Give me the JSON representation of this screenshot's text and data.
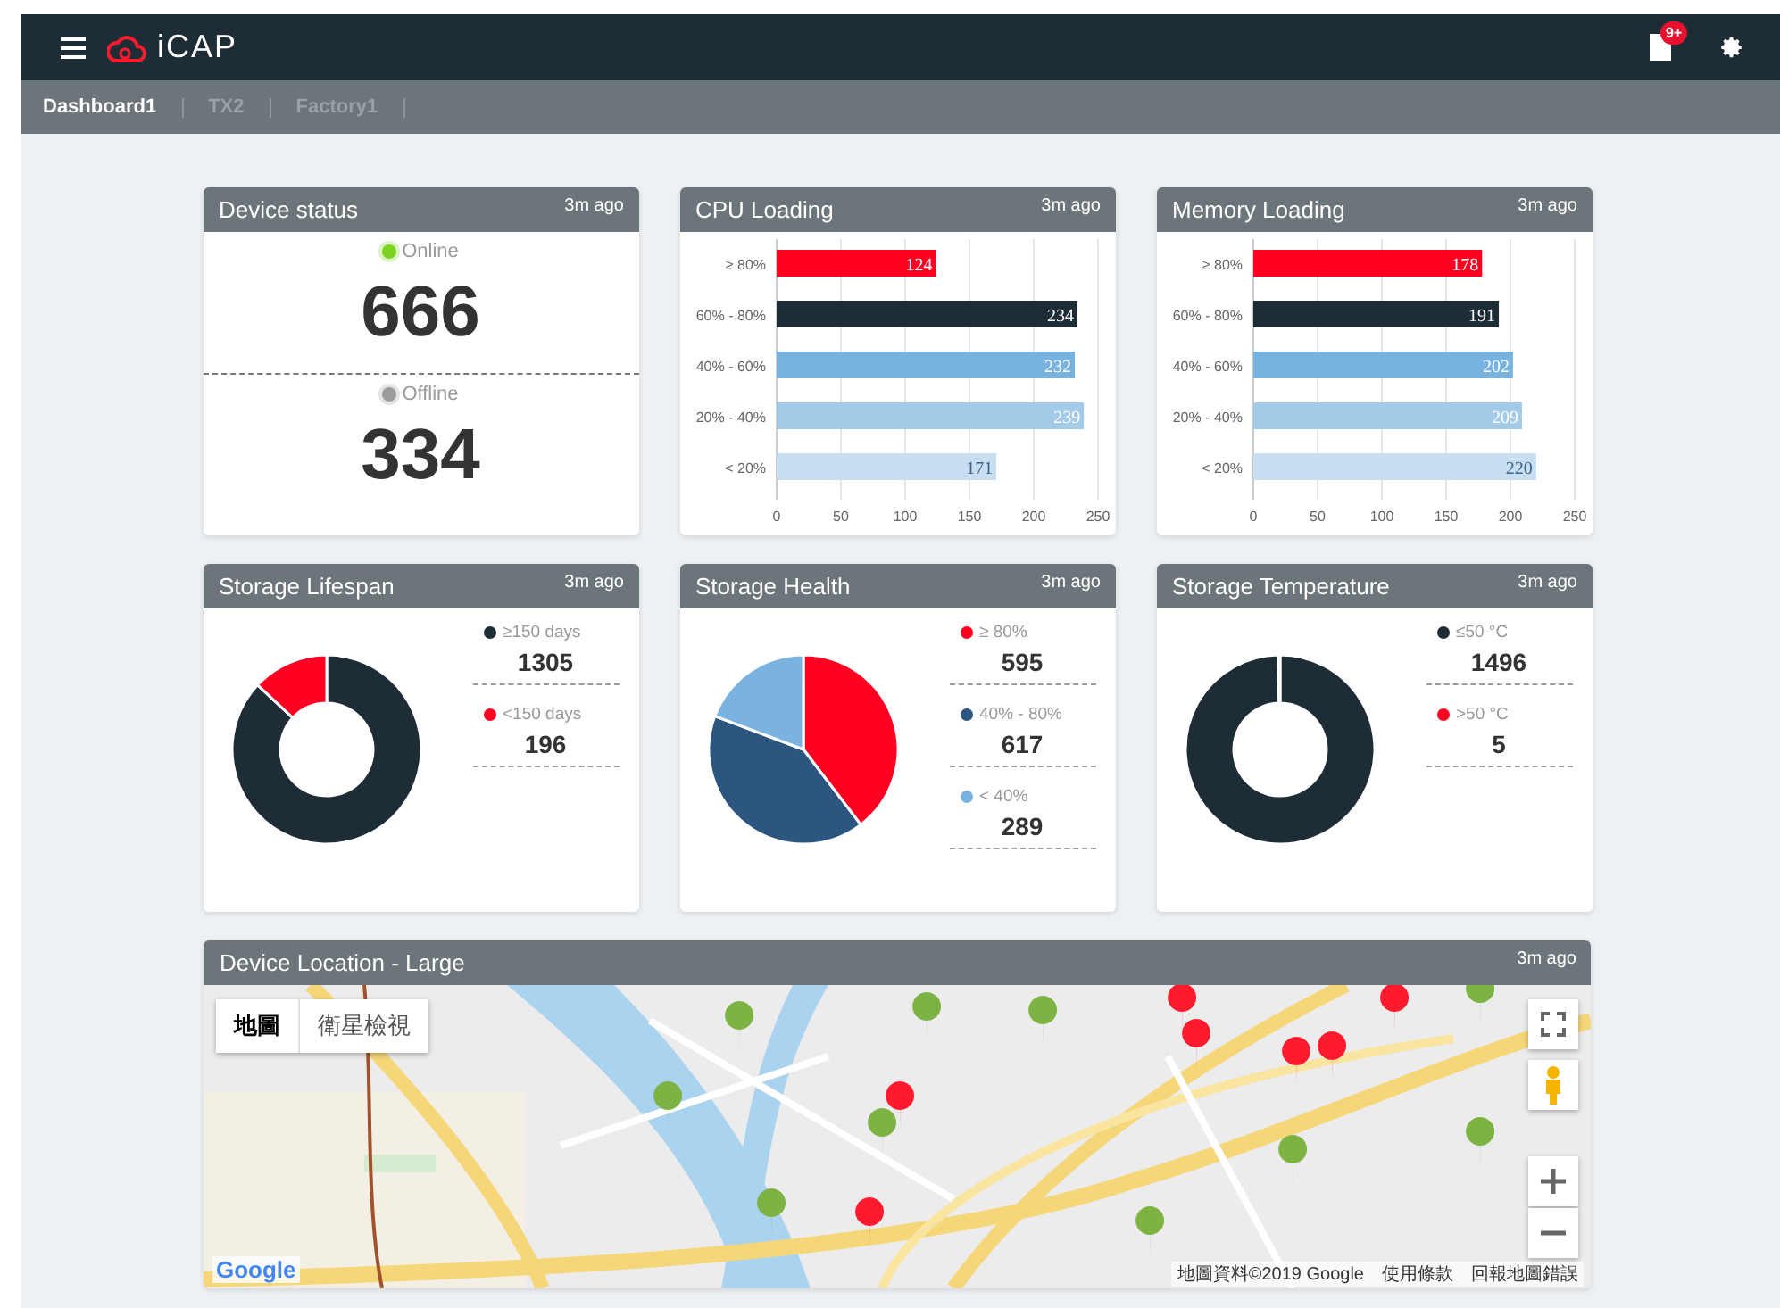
{
  "header": {
    "logo": "iCAP",
    "notification_badge": "9+"
  },
  "tabs": [
    {
      "label": "Dashboard1",
      "selected": true
    },
    {
      "label": "TX2",
      "selected": false
    },
    {
      "label": "Factory1",
      "selected": false
    }
  ],
  "cards": [
    {
      "kind": "status",
      "title": "Device status",
      "updated": "3m ago",
      "statuses": [
        {
          "label": "Online",
          "value": "666",
          "color": "#7ed321"
        },
        {
          "label": "Offline",
          "value": "334",
          "color": "#9b9b9b"
        }
      ]
    },
    {
      "kind": "bar",
      "title": "CPU Loading",
      "updated": "3m ago",
      "chart_data": {
        "type": "bar",
        "orientation": "horizontal",
        "categories": [
          "≥ 80%",
          "60% - 80%",
          "40% - 60%",
          "20% - 40%",
          "< 20%"
        ],
        "values": [
          124,
          234,
          232,
          239,
          171
        ],
        "grid": true,
        "colors": [
          "#ff0022",
          "#1e2d35",
          "#78b3df",
          "#a3cbe8",
          "#c8dff2"
        ],
        "xlim": [
          0,
          250
        ],
        "xticks": [
          0,
          50,
          100,
          150,
          200,
          250
        ],
        "data_labels": true
      }
    },
    {
      "kind": "bar",
      "title": "Memory Loading",
      "updated": "3m ago",
      "chart_data": {
        "type": "bar",
        "orientation": "horizontal",
        "categories": [
          "≥ 80%",
          "60% - 80%",
          "40% - 60%",
          "20% - 40%",
          "< 20%"
        ],
        "values": [
          178,
          191,
          202,
          209,
          220
        ],
        "grid": true,
        "colors": [
          "#ff0022",
          "#1e2d35",
          "#78b3df",
          "#a3cbe8",
          "#c8dff2"
        ],
        "xlim": [
          0,
          250
        ],
        "xticks": [
          0,
          50,
          100,
          150,
          200,
          250
        ],
        "data_labels": true
      }
    },
    {
      "kind": "pie",
      "title": "Storage Lifespan",
      "updated": "3m ago",
      "chart_data": {
        "type": "donut",
        "categories": [
          "≥150 days",
          "<150 days"
        ],
        "values": [
          1305,
          196
        ],
        "legend": "right",
        "colors": [
          "#1e2d35",
          "#ff0022"
        ],
        "value_labels": [
          "1305",
          "196"
        ]
      }
    },
    {
      "kind": "pie",
      "title": "Storage Health",
      "updated": "3m ago",
      "chart_data": {
        "type": "pie",
        "categories": [
          "≥ 80%",
          "40% - 80%",
          "< 40%"
        ],
        "values": [
          595,
          617,
          289
        ],
        "legend": "right",
        "colors": [
          "#ff0022",
          "#2c5680",
          "#7ab3df"
        ],
        "value_labels": [
          "595",
          "617",
          "289"
        ]
      }
    },
    {
      "kind": "pie",
      "title": "Storage Temperature",
      "updated": "3m ago",
      "chart_data": {
        "type": "donut",
        "categories": [
          "≤50 °C",
          ">50 °C"
        ],
        "values": [
          1496,
          5
        ],
        "legend": "right",
        "colors": [
          "#1e2d35",
          "#ff0022"
        ],
        "value_labels": [
          "1496",
          "5"
        ]
      }
    }
  ],
  "map": {
    "title": "Device Location - Large",
    "updated": "3m ago",
    "map_types": [
      {
        "label": "地圖",
        "selected": true
      },
      {
        "label": "衛星檢視",
        "selected": false
      }
    ],
    "logo": "Google",
    "attribution": [
      "地圖資料©2019 Google",
      "使用條款",
      "回報地圖錯誤"
    ]
  }
}
